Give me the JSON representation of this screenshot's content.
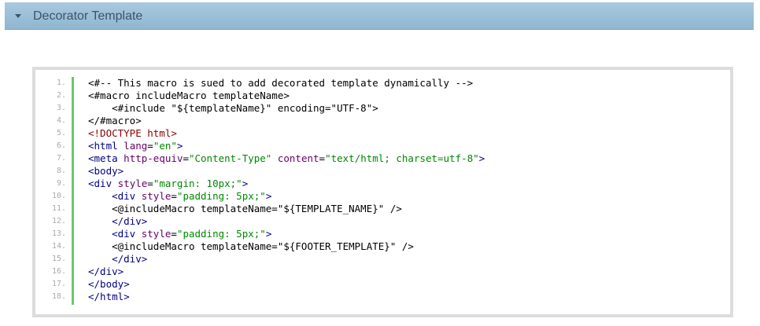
{
  "header": {
    "title": "Decorator Template"
  },
  "code": {
    "lines": [
      {
        "n": "1.",
        "indent": "",
        "text": "<#-- This macro is sued to add decorated template dynamically -->"
      },
      {
        "n": "2.",
        "indent": "",
        "text": "<#macro includeMacro templateName>"
      },
      {
        "n": "3.",
        "indent": "    ",
        "text": "<#include \"${templateName}\" encoding=\"UTF-8\">"
      },
      {
        "n": "4.",
        "indent": "",
        "text": "</#macro>"
      },
      {
        "n": "5.",
        "indent": "",
        "text": "<!DOCTYPE html>"
      },
      {
        "n": "6.",
        "indent": "",
        "text": "<html lang=\"en\">"
      },
      {
        "n": "7.",
        "indent": "",
        "text": "<meta http-equiv=\"Content-Type\" content=\"text/html; charset=utf-8\">"
      },
      {
        "n": "8.",
        "indent": "",
        "text": "<body>"
      },
      {
        "n": "9.",
        "indent": "",
        "text": "<div style=\"margin: 10px;\">"
      },
      {
        "n": "10.",
        "indent": "    ",
        "text": "<div style=\"padding: 5px;\">"
      },
      {
        "n": "11.",
        "indent": "    ",
        "text": "<@includeMacro templateName=\"${TEMPLATE_NAME}\" />"
      },
      {
        "n": "12.",
        "indent": "    ",
        "text": "</div>"
      },
      {
        "n": "13.",
        "indent": "    ",
        "text": "<div style=\"padding: 5px;\">"
      },
      {
        "n": "14.",
        "indent": "    ",
        "text": "<@includeMacro templateName=\"${FOOTER_TEMPLATE}\" />"
      },
      {
        "n": "15.",
        "indent": "    ",
        "text": "</div>"
      },
      {
        "n": "16.",
        "indent": "",
        "text": "</div>"
      },
      {
        "n": "17.",
        "indent": "",
        "text": "</body>"
      },
      {
        "n": "18.",
        "indent": "",
        "text": "</html>"
      }
    ]
  },
  "colors": {
    "header_bg": "#9fc0d8",
    "title": "#3b5466",
    "gutter_bar": "#6cc66c",
    "tag": "#000088",
    "attr_name": "#660066",
    "attr_value": "#008800",
    "doctype": "#880000"
  }
}
